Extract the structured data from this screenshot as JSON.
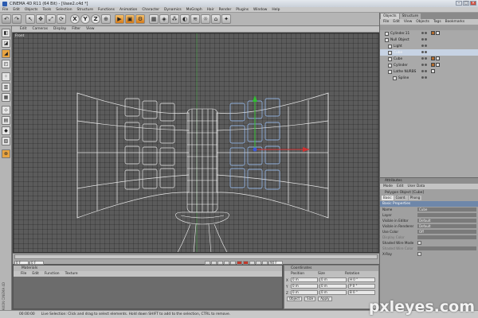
{
  "window": {
    "title": "CINEMA 4D R11 (64 Bit) - [Vase2.c4d *]"
  },
  "menubar": [
    "File",
    "Edit",
    "Objects",
    "Tools",
    "Selection",
    "Structure",
    "Functions",
    "Animation",
    "Character",
    "Dynamics",
    "MoGraph",
    "Hair",
    "Render",
    "Plugins",
    "Window",
    "Help"
  ],
  "viewport": {
    "menu": [
      "Edit",
      "Cameras",
      "Display",
      "Filter",
      "View"
    ],
    "label": "Front"
  },
  "timeline": {
    "frame_start": "0 F",
    "frame_cur": "0 F",
    "frame_end": "90 F"
  },
  "materials": {
    "title": "Materials",
    "menu": [
      "File",
      "Edit",
      "Function",
      "Texture"
    ]
  },
  "coordinates": {
    "title": "Coordinates",
    "cols": [
      "Position",
      "Size",
      "Rotation"
    ],
    "rows": [
      {
        "axis": "X",
        "pos": "0 m",
        "size": "0 m",
        "rot": "H 0 °"
      },
      {
        "axis": "Y",
        "pos": "0 m",
        "size": "0 m",
        "rot": "P 0 °"
      },
      {
        "axis": "Z",
        "pos": "0 m",
        "size": "0 m",
        "rot": "B 0 °"
      }
    ],
    "mode_a": "Object",
    "mode_b": "Size",
    "apply": "Apply"
  },
  "status": {
    "time": "00:00:00",
    "text": "Live Selection: Click and drag to select elements. Hold down SHIFT to add to the selection, CTRL to remove."
  },
  "right": {
    "tabs": [
      "Objects",
      "Structure"
    ],
    "menu": [
      "File",
      "Edit",
      "View",
      "Objects",
      "Tags",
      "Bookmarks"
    ],
    "objects": [
      "Cylinder.11",
      "Null Object",
      "Light",
      "Cube",
      "Cube",
      "Cylinder",
      "Lathe NURBS",
      "Spline"
    ],
    "attr_title": "Attributes",
    "attr_menu": [
      "Mode",
      "Edit",
      "User Data"
    ],
    "attr_object": "Polygon Object [Cube]",
    "attr_tabs": [
      "Basic",
      "Coord.",
      "Phong"
    ],
    "section": "Basic Properties",
    "props": [
      {
        "label": "Name",
        "value": "Cube"
      },
      {
        "label": "Layer",
        "value": ""
      },
      {
        "label": "Visible in Editor",
        "value": "Default"
      },
      {
        "label": "Visible in Renderer",
        "value": "Default"
      },
      {
        "label": "Use Color",
        "value": "Off"
      },
      {
        "label": "Display Color",
        "value": ""
      },
      {
        "label": "Shaded Wire Mode",
        "value": ""
      },
      {
        "label": "Shaded Wire Color",
        "value": ""
      },
      {
        "label": "X-Ray",
        "value": ""
      }
    ]
  },
  "lefttools_label": "MAXON CINEMA 4D",
  "watermark": "pxleyes.com"
}
